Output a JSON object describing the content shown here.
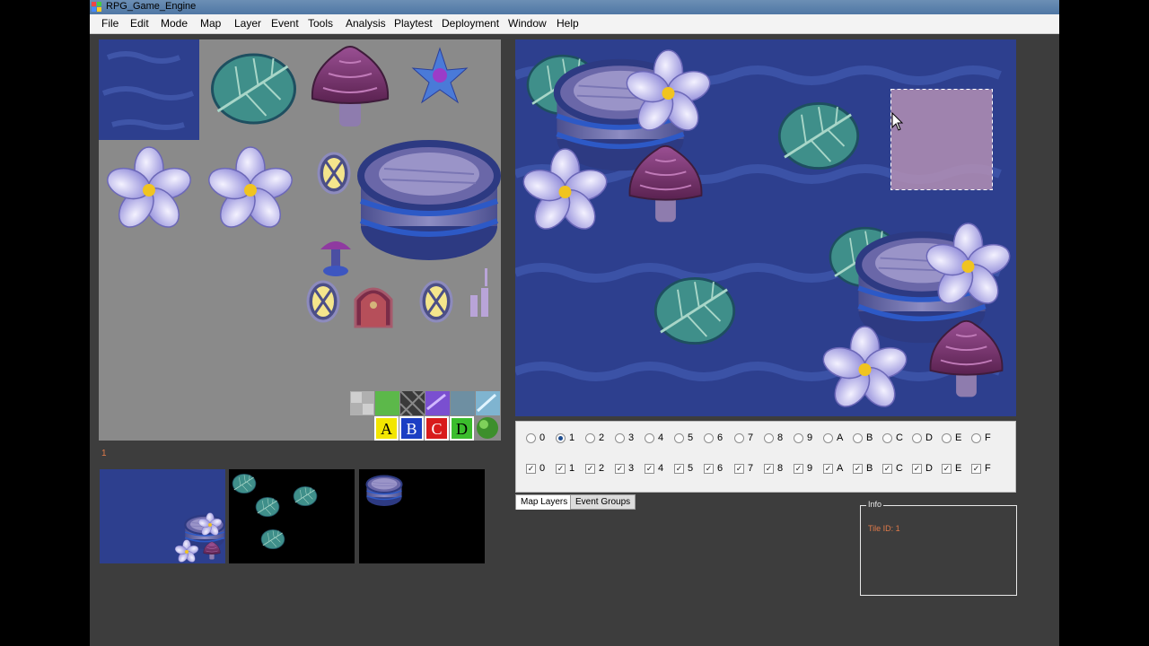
{
  "window": {
    "title": "RPG_Game_Engine"
  },
  "menu": [
    "File",
    "Edit",
    "Mode",
    "Map",
    "Layer",
    "Event",
    "Tools",
    "Analysis",
    "Playtest",
    "Deployment",
    "Window",
    "Help"
  ],
  "palette": {
    "letters": [
      "A",
      "B",
      "C",
      "D"
    ],
    "letter_colors": [
      "#f3e600",
      "#1b3ec4",
      "#d81c1c",
      "#3bbd2d"
    ]
  },
  "layer_indicator": "1",
  "layer_panel": {
    "radio_labels": [
      "0",
      "1",
      "2",
      "3",
      "4",
      "5",
      "6",
      "7",
      "8",
      "9",
      "A",
      "B",
      "C",
      "D",
      "E",
      "F"
    ],
    "radio_selected": "1",
    "checkbox_labels": [
      "0",
      "1",
      "2",
      "3",
      "4",
      "5",
      "6",
      "7",
      "8",
      "9",
      "A",
      "B",
      "C",
      "D",
      "E",
      "F"
    ],
    "checkbox_checked": [
      true,
      true,
      true,
      true,
      true,
      true,
      true,
      true,
      true,
      true,
      true,
      true,
      true,
      true,
      true,
      true
    ],
    "check_mark": "✓"
  },
  "tabs": {
    "map_layers": "Map Layers",
    "event_groups": "Event Groups"
  },
  "info": {
    "title": "Info",
    "tile_id": "Tile ID: 1"
  },
  "colors": {
    "water": "#2d3f8e",
    "selection": "#b48fb4",
    "accent": "#e07a4a"
  }
}
